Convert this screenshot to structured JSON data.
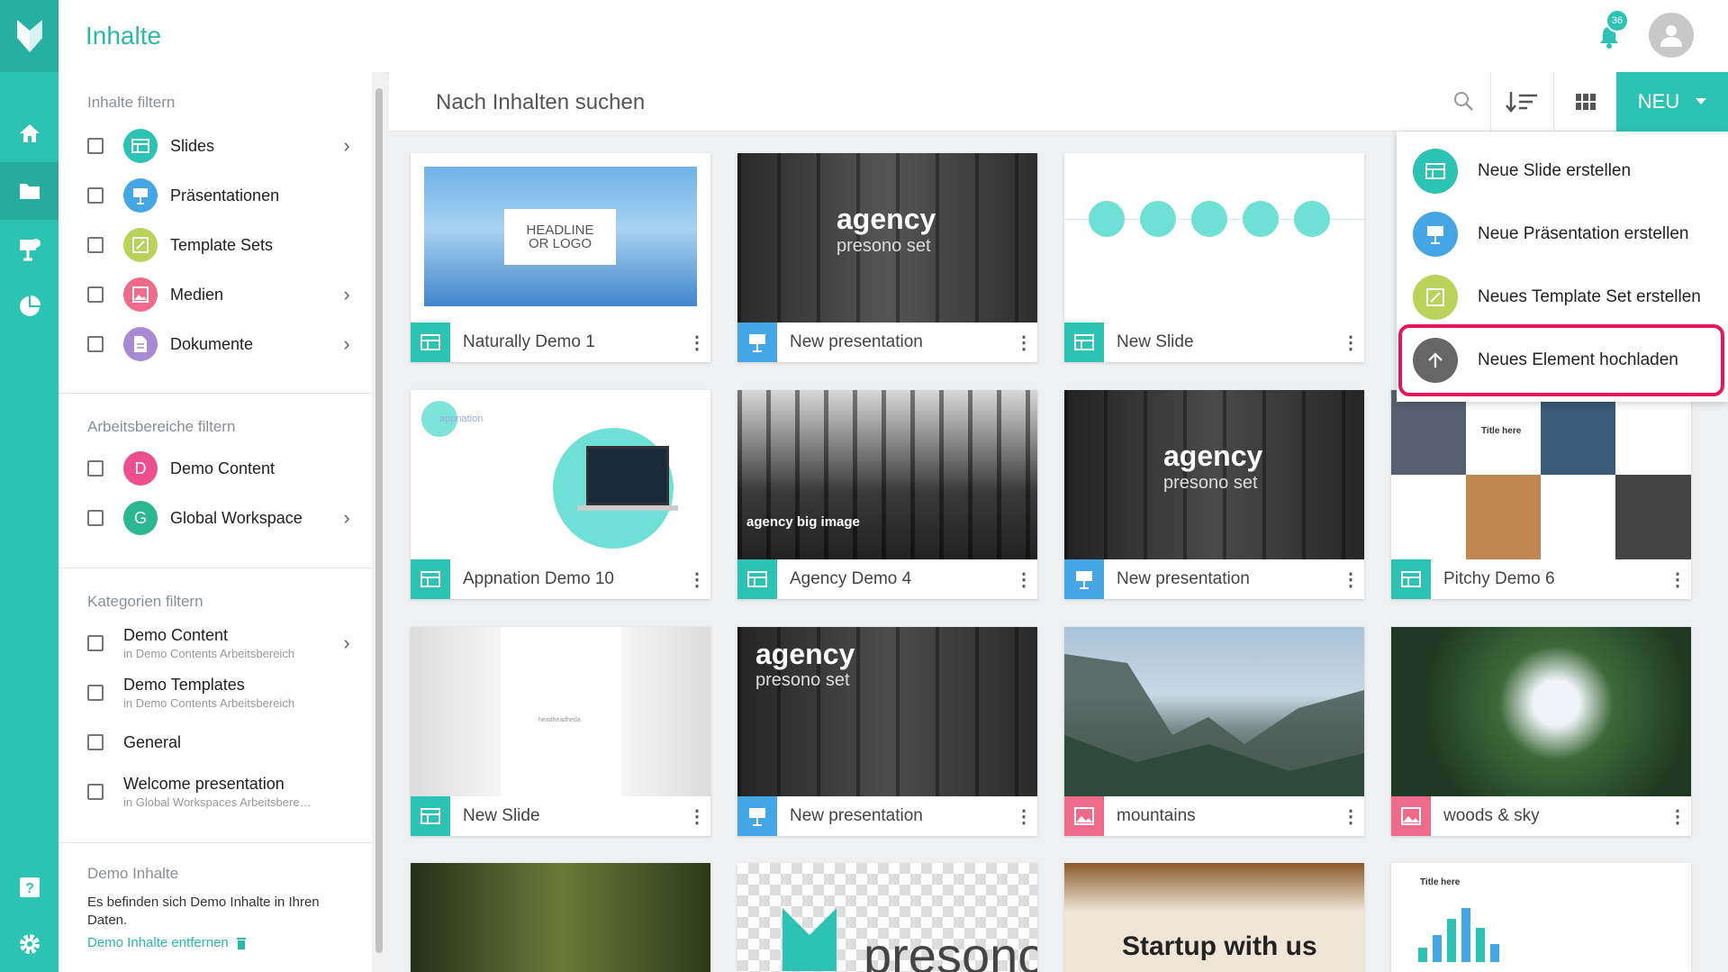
{
  "header": {
    "title": "Inhalte",
    "notification_count": "36"
  },
  "search": {
    "placeholder": "Nach Inhalten suchen",
    "new_label": "NEU"
  },
  "sidebar": {
    "content_filter_title": "Inhalte filtern",
    "content_filters": [
      {
        "label": "Slides",
        "color": "#2cc3b4",
        "has_children": true
      },
      {
        "label": "Präsentationen",
        "color": "#45a6e6",
        "has_children": false
      },
      {
        "label": "Template Sets",
        "color": "#b9d35a",
        "has_children": false
      },
      {
        "label": "Medien",
        "color": "#f06a8a",
        "has_children": true
      },
      {
        "label": "Dokumente",
        "color": "#a889d3",
        "has_children": true
      }
    ],
    "workspace_filter_title": "Arbeitsbereiche filtern",
    "workspaces": [
      {
        "letter": "D",
        "label": "Demo Content",
        "color": "#ec4f8e"
      },
      {
        "letter": "G",
        "label": "Global Workspace",
        "color": "#2cb88e"
      }
    ],
    "category_filter_title": "Kategorien filtern",
    "categories": [
      {
        "label": "Demo Content",
        "sub": "in Demo Contents Arbeitsbereich"
      },
      {
        "label": "Demo Templates",
        "sub": "in Demo Contents Arbeitsbereich"
      },
      {
        "label": "General",
        "sub": ""
      },
      {
        "label": "Welcome presentation",
        "sub": "in Global Workspaces Arbeitsbereich"
      }
    ],
    "demo": {
      "title": "Demo Inhalte",
      "text": "Es befinden sich Demo Inhalte in Ihren Daten.",
      "link": "Demo Inhalte entfernen"
    }
  },
  "cards": [
    {
      "title": "Naturally Demo 1",
      "kind": "slide",
      "thumb_text": "HEADLINE OR LOGO"
    },
    {
      "title": "New presentation",
      "kind": "presentation",
      "thumb_text": "agency",
      "thumb_sub": "presono set"
    },
    {
      "title": "New Slide",
      "kind": "slide",
      "thumb_text": ""
    },
    {
      "title": "Appnation Demo 10",
      "kind": "slide",
      "thumb_text": "appnation"
    },
    {
      "title": "Agency Demo 4",
      "kind": "slide",
      "thumb_text": "agency big image"
    },
    {
      "title": "New presentation",
      "kind": "presentation",
      "thumb_text": "agency",
      "thumb_sub": "presono set"
    },
    {
      "title": "Pitchy Demo 6",
      "kind": "slide",
      "thumb_text": "Title here"
    },
    {
      "title": "New Slide",
      "kind": "slide",
      "thumb_text": "headheadheda"
    },
    {
      "title": "New presentation",
      "kind": "presentation",
      "thumb_text": "agency",
      "thumb_sub": "presono set"
    },
    {
      "title": "mountains",
      "kind": "media",
      "thumb_text": ""
    },
    {
      "title": "woods & sky",
      "kind": "media",
      "thumb_text": ""
    },
    {
      "title": "",
      "kind": "media",
      "thumb_text": ""
    },
    {
      "title": "",
      "kind": "media",
      "thumb_text": "presono"
    },
    {
      "title": "",
      "kind": "slide",
      "thumb_text": "Startup with us"
    },
    {
      "title": "",
      "kind": "slide",
      "thumb_text": "Title here"
    }
  ],
  "new_menu": {
    "items": [
      {
        "label": "Neue Slide erstellen",
        "color": "#2cc3b4"
      },
      {
        "label": "Neue Präsentation erstellen",
        "color": "#45a6e6"
      },
      {
        "label": "Neues Template Set erstellen",
        "color": "#b9d35a"
      },
      {
        "label": "Neues Element hochladen",
        "color": "#666666"
      }
    ]
  }
}
